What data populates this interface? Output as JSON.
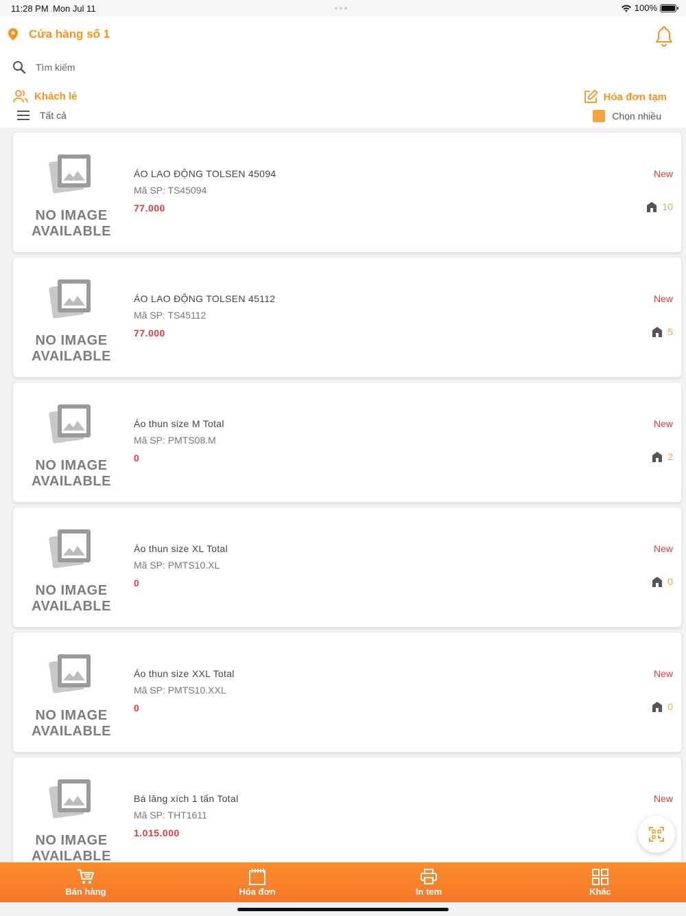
{
  "status_bar": {
    "time": "11:28 PM",
    "date": "Mon Jul 11",
    "battery": "100%"
  },
  "header": {
    "store_name": "Cửa hàng số 1",
    "search_placeholder": "Tìm kiếm",
    "customer_label": "Khách lẻ",
    "temp_invoice_label": "Hóa đơn tạm",
    "filter_label": "Tất cả",
    "multi_select_label": "Chọn nhiều"
  },
  "no_image_text": [
    "NO IMAGE",
    "AVAILABLE"
  ],
  "products": [
    {
      "name": "ÁO LAO ĐỘNG TOLSEN 45094",
      "sku": "Mã SP: TS45094",
      "price": "77.000",
      "tag": "New",
      "stock": "10"
    },
    {
      "name": "ÁO LAO ĐỘNG TOLSEN 45112",
      "sku": "Mã SP: TS45112",
      "price": "77.000",
      "tag": "New",
      "stock": "5"
    },
    {
      "name": "Áo thun size M Total",
      "sku": "Mã SP: PMTS08.M",
      "price": "0",
      "tag": "New",
      "stock": "2"
    },
    {
      "name": "Áo thun size XL Total",
      "sku": "Mã SP: PMTS10.XL",
      "price": "0",
      "tag": "New",
      "stock": "0"
    },
    {
      "name": "Áo thun size XXL Total",
      "sku": "Mã SP: PMTS10.XXL",
      "price": "0",
      "tag": "New",
      "stock": "0"
    },
    {
      "name": "Bá lăng xích 1 tấn Total",
      "sku": "Mã SP: THT1611",
      "price": "1.015.000",
      "tag": "New",
      "stock": ""
    }
  ],
  "tabs": [
    {
      "label": "Bán hàng",
      "icon": "cart-icon"
    },
    {
      "label": "Hóa đơn",
      "icon": "invoice-icon"
    },
    {
      "label": "In tem",
      "icon": "printer-icon"
    },
    {
      "label": "Khác",
      "icon": "grid-icon"
    }
  ],
  "colors": {
    "accent": "#f7931e",
    "price": "#e53935",
    "tab_bar": "#fb8c2a"
  }
}
